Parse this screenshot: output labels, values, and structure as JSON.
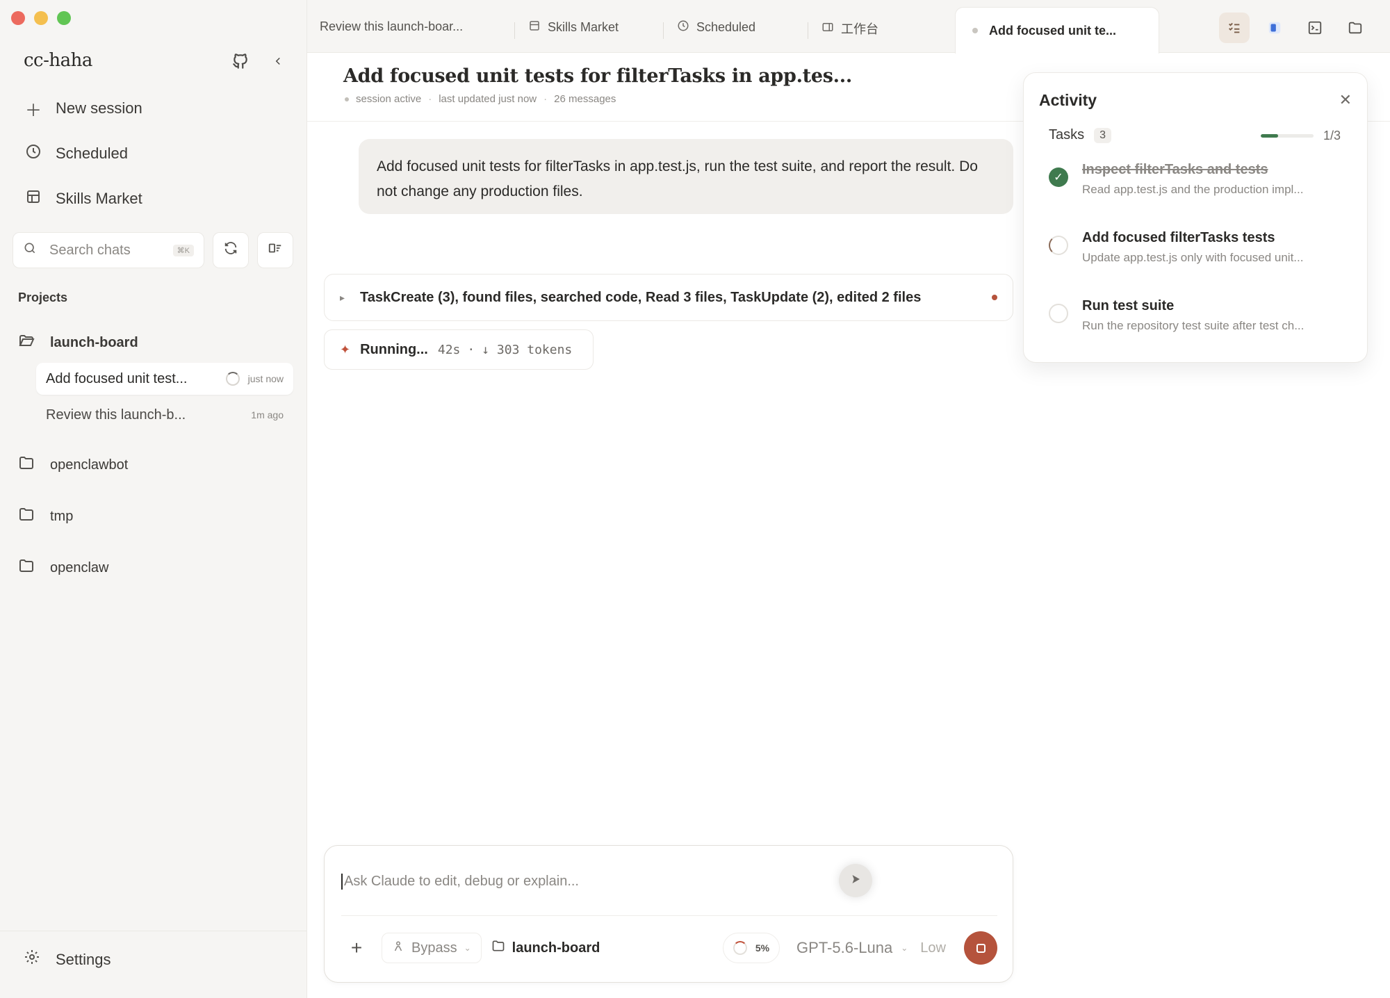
{
  "window": {
    "controls": [
      "close",
      "minimize",
      "maximize"
    ]
  },
  "sidebar": {
    "brand": "cc-haha",
    "nav": [
      {
        "label": "New session",
        "icon": "plus-icon"
      },
      {
        "label": "Scheduled",
        "icon": "clock-icon"
      },
      {
        "label": "Skills Market",
        "icon": "store-icon"
      }
    ],
    "search": {
      "placeholder": "Search chats",
      "shortcut": "⌘K"
    },
    "projects_label": "Projects",
    "projects": [
      {
        "name": "launch-board",
        "open": true,
        "sessions": [
          {
            "title": "Add focused unit test...",
            "time": "just now",
            "active": true
          },
          {
            "title": "Review this launch-b...",
            "time": "1m ago",
            "active": false
          }
        ]
      },
      {
        "name": "openclawbot",
        "open": false
      },
      {
        "name": "tmp",
        "open": false
      },
      {
        "name": "openclaw",
        "open": false
      }
    ],
    "settings_label": "Settings"
  },
  "tabs": [
    {
      "label": "Review this launch-boar...",
      "icon": ""
    },
    {
      "label": "Skills Market",
      "icon": "store-icon"
    },
    {
      "label": "Scheduled",
      "icon": "clock-icon"
    },
    {
      "label": "工作台",
      "icon": "workspace-icon"
    },
    {
      "label": "Add focused unit te...",
      "icon": "dot",
      "active": true
    }
  ],
  "header": {
    "title": "Add focused unit tests for filterTasks in app.tes...",
    "status": "session active",
    "updated": "last updated just now",
    "messages": "26 messages"
  },
  "chat": {
    "user_message": "Add focused unit tests for filterTasks in app.test.js, run the test suite, and report the result. Do not change any production files.",
    "tool_summary": "TaskCreate (3), found files, searched code, Read 3 files, TaskUpdate (2), edited 2 files",
    "running": {
      "label": "Running...",
      "elapsed": "42s",
      "tokens": "↓ 303 tokens"
    }
  },
  "composer": {
    "placeholder": "Ask Claude to edit, debug or explain...",
    "mode": "Bypass",
    "folder": "launch-board",
    "context": "5%",
    "model": "GPT-5.6-Luna",
    "effort": "Low"
  },
  "activity": {
    "title": "Activity",
    "tasks_label": "Tasks",
    "tasks_count": "3",
    "progress_text": "1/3",
    "progress_fraction": 0.333,
    "tasks": [
      {
        "title": "Inspect filterTasks and tests",
        "desc": "Read app.test.js and the production impl...",
        "status": "done"
      },
      {
        "title": "Add focused filterTasks tests",
        "desc": "Update app.test.js only with focused unit...",
        "status": "in-progress"
      },
      {
        "title": "Run test suite",
        "desc": "Run the repository test suite after test ch...",
        "status": "todo"
      }
    ]
  },
  "colors": {
    "accent": "#b5533c",
    "success": "#3f7a4e",
    "sidebar_bg": "#f6f5f3"
  }
}
